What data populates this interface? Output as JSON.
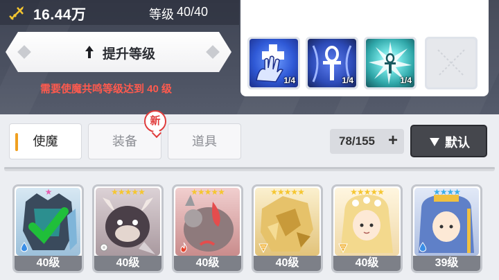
{
  "header": {
    "power_value": "16.44万",
    "level_label": "等级",
    "level_current": "40",
    "level_max": "40"
  },
  "upgrade": {
    "button_label": "提升等级",
    "requirement_text": "需要使魔共鸣等级达到 40 级"
  },
  "skills": [
    {
      "icon": "hand-cross-skill-icon",
      "count": "1/4",
      "color": "#2f59d6"
    },
    {
      "icon": "ankh-skill-icon",
      "count": "1/4",
      "color": "#2d4bb8"
    },
    {
      "icon": "burst-ankh-skill-icon",
      "count": "1/4",
      "color": "#2fa6a8"
    },
    {
      "icon": "empty-slot-icon",
      "count": ""
    }
  ],
  "tabs": [
    {
      "label": "使魔",
      "active": true
    },
    {
      "label": "装备",
      "active": false
    },
    {
      "label": "道具",
      "active": false
    }
  ],
  "new_badge": "新",
  "inventory": {
    "count": "78/155",
    "plus": "+"
  },
  "sort": {
    "label": "默认"
  },
  "cards": [
    {
      "stars": "★",
      "star_color": "#e65fb0",
      "level": "40级",
      "element": "water",
      "bg": "#b7d3e6",
      "checked": true
    },
    {
      "stars": "★★★★★",
      "star_color": "#f5c630",
      "level": "40级",
      "element": "light",
      "bg": "#c9bcc0",
      "checked": false
    },
    {
      "stars": "★★★★★",
      "star_color": "#f5c630",
      "level": "40级",
      "element": "fire",
      "bg": "#e8b2b2",
      "checked": false
    },
    {
      "stars": "★★★★★",
      "star_color": "#f5c630",
      "level": "40级",
      "element": "wind",
      "bg": "#f0deaa",
      "checked": false
    },
    {
      "stars": "★★★★★",
      "star_color": "#f5c630",
      "level": "40级",
      "element": "wind",
      "bg": "#f5e5c0",
      "checked": false
    },
    {
      "stars": "★★★★",
      "star_color": "#3aaee8",
      "level": "39级",
      "element": "water",
      "bg": "#c8d5ee",
      "checked": false
    }
  ]
}
